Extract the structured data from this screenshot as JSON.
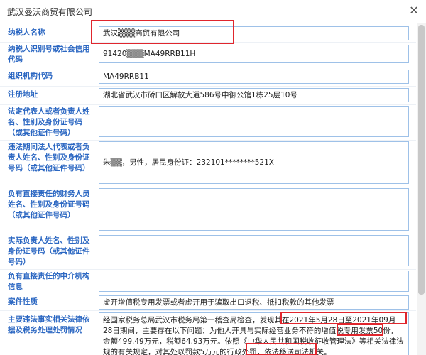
{
  "dialog": {
    "title": "武汉曼沃商贸有限公司",
    "close_icon": "close-icon"
  },
  "fields": [
    {
      "label": "纳税人名称",
      "value": "武汉▒▒▒商贸有限公司"
    },
    {
      "label": "纳税人识别号或社会信用代码",
      "value": "91420▒▒▒MA49RRB11H"
    },
    {
      "label": "组织机构代码",
      "value": "MA49RRB11"
    },
    {
      "label": "注册地址",
      "value": "湖北省武汉市硚口区解放大道586号中御公馆1栋25层10号"
    },
    {
      "label": "法定代表人或者负责人姓名、性别及身份证号码（或其他证件号码）",
      "value": ""
    },
    {
      "label": "违法期间法人代表或者负责人姓名、性别及身份证号码（或其他证件号码）",
      "value": "朱▒▒，男性，居民身份证：232101********521X"
    },
    {
      "label": "负有直接责任的财务人员姓名、性别及身份证号码（或其他证件号码）",
      "value": ""
    },
    {
      "label": "实际负责人姓名、性别及身份证号码（或其他证件号码）",
      "value": ""
    },
    {
      "label": "负有直接责任的中介机构信息",
      "value": ""
    },
    {
      "label": "案件性质",
      "value": "虚开增值税专用发票或者虚开用于骗取出口退税、抵扣税款的其他发票"
    },
    {
      "label": "主要违法事实相关法律依据及税务处理处罚情况",
      "value": "经国家税务总局武汉市税务局第一稽查局检查，发现其在2021年5月28日至2021年09月28日期间，主要存在以下问题：为他人开具与实际经营业务不符的增值税专用发票50份，金额499.49万元，税额64.93万元。依照《中华人民共和国税收征收管理法》等相关法律法规的有关规定，对其处以罚款5万元的行政处罚，依法移送司法机关。"
    }
  ]
}
